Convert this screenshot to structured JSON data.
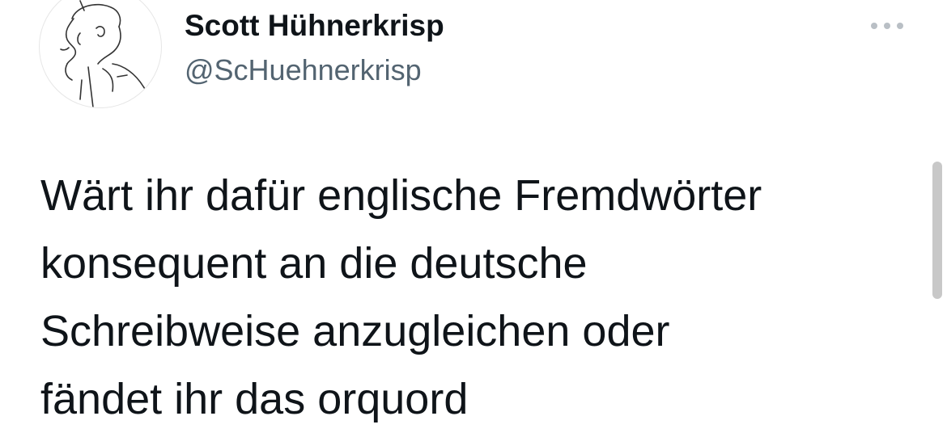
{
  "tweet": {
    "author": {
      "display_name": "Scott Hühnerkrisp",
      "handle": "@ScHuehnerkrisp",
      "avatar_icon": "sketch-portrait-avatar"
    },
    "menu_icon": "more-options-icon",
    "text_lines": [
      "Wärt ihr dafür englische Fremdwörter",
      "konsequent an die deutsche",
      "Schreibweise anzugleichen oder",
      "fändet ihr das orquord"
    ]
  },
  "colors": {
    "text": "#0f1419",
    "secondary_text": "#536471",
    "more_icon": "#b9bfc5",
    "scrollbar": "#c8c8c8",
    "background": "#ffffff"
  }
}
